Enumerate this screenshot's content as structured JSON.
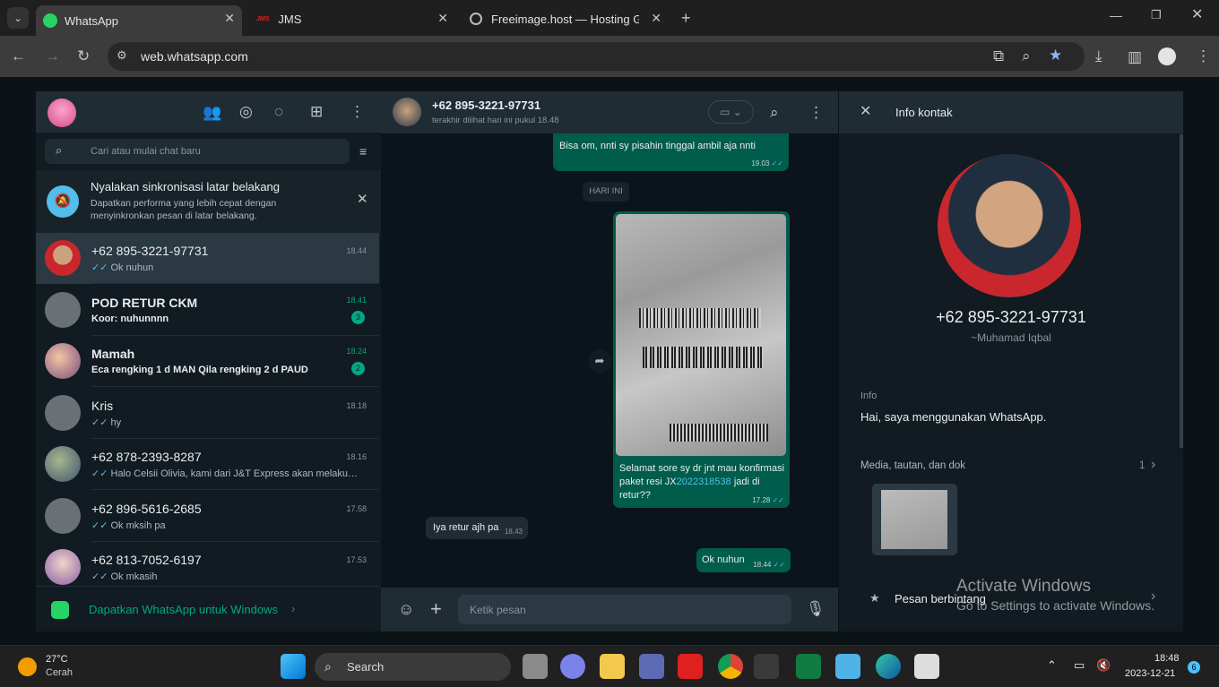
{
  "browser": {
    "tabs": [
      {
        "title": "WhatsApp",
        "active": true
      },
      {
        "title": "JMS",
        "active": false
      },
      {
        "title": "Freeimage.host — Hosting Gam",
        "active": false
      }
    ],
    "jms_logo": "JMS",
    "url": "web.whatsapp.com"
  },
  "colors": {
    "accent": "#00a884",
    "outgoing": "#005c4b",
    "incoming": "#202c33",
    "panel": "#111b21",
    "tick": "#53bdeb"
  },
  "sidebar": {
    "search_placeholder": "Cari atau mulai chat baru",
    "banner_title": "Nyalakan sinkronisasi latar belakang",
    "banner_text": "Dapatkan performa yang lebih cepat dengan menyinkronkan pesan di latar belakang.",
    "chats": [
      {
        "name": "+62 895-3221-97731",
        "msg": "Ok nuhun",
        "time": "18.44",
        "ticks": true
      },
      {
        "name": "POD RETUR CKM",
        "msg": "Koor: nuhunnnn",
        "time": "18.41",
        "unread": "3",
        "bold": true
      },
      {
        "name": "Mamah",
        "msg": "Eca rengking 1 d MAN Qila rengking 2 d PAUD",
        "time": "18.24",
        "unread": "2",
        "bold": true
      },
      {
        "name": "Kris",
        "msg": "hy",
        "time": "18.18",
        "ticks": true
      },
      {
        "name": "+62 878-2393-8287",
        "msg": "Halo Celsii Olivia, kami dari J&T Express akan melakuka...",
        "time": "18.16",
        "ticks": true
      },
      {
        "name": "+62 896-5616-2685",
        "msg": "Ok mksih pa",
        "time": "17.58",
        "ticks": true
      },
      {
        "name": "+62 813-7052-6197",
        "msg": "Ok mkasih",
        "time": "17.53",
        "ticks": true
      }
    ],
    "footer": "Dapatkan WhatsApp untuk Windows"
  },
  "conversation": {
    "name": "+62 895-3221-97731",
    "status": "terakhir dilihat hari ini pukul 18.48",
    "messages": [
      {
        "text": "Bisa om, nnti sy pisahin tinggal ambil aja nnti",
        "time": "19.03"
      },
      {
        "date": "HARI INI"
      },
      {
        "text_prefix": "Selamat sore sy dr jnt mau konfirmasi paket resi JX",
        "resi": "2022318538",
        "text_suffix": " jadi di retur??",
        "time": "17.28"
      },
      {
        "text": "Iya retur ajh pa",
        "time": "18.43"
      },
      {
        "text": "Ok nuhun",
        "time": "18.44"
      }
    ],
    "composer_placeholder": "Ketik pesan"
  },
  "info": {
    "title": "Info kontak",
    "phone": "+62 895-3221-97731",
    "alias": "~Muhamad Iqbal",
    "about_label": "Info",
    "about": "Hai, saya menggunakan WhatsApp.",
    "media_label": "Media, tautan, dan dok",
    "media_count": "1",
    "starred": "Pesan berbintang"
  },
  "watermark": {
    "line1": "Activate Windows",
    "line2": "Go to Settings to activate Windows."
  },
  "taskbar": {
    "temp": "27°C",
    "weather": "Cerah",
    "search": "Search",
    "time": "18:48",
    "date": "2023-12-21",
    "notif": "6"
  }
}
